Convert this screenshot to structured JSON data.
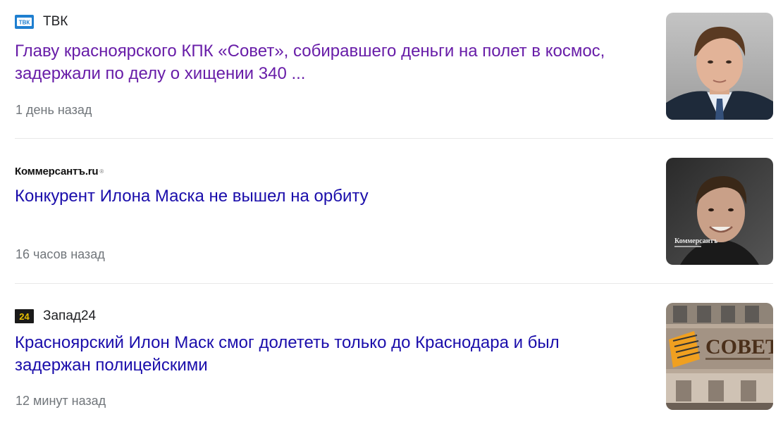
{
  "news": [
    {
      "source": "ТВК",
      "source_logo_text": "ТВК",
      "headline": "Главу красноярского КПК «Совет», собиравшего деньги на полет в космос, задержали по делу о хищении 340 ...",
      "time": "1 день назад",
      "visited": true
    },
    {
      "source": "",
      "source_logo_text": "Коммерсантъ.ru",
      "headline": "Конкурент Илона Маска не вышел на орбиту",
      "time": "16 часов назад",
      "thumb_watermark": "Коммерсантъ",
      "visited": false
    },
    {
      "source": "Запад24",
      "source_logo_text": "24",
      "headline": "Красноярский Илон Маск смог долететь только до Краснодара и был задержан полицейскими",
      "time": "12 минут назад",
      "thumb_sign_text": "СОВЕТ",
      "visited": false
    }
  ],
  "colors": {
    "visited_link": "#681da8",
    "link": "#1a0dab",
    "meta": "#70757a",
    "source_text": "#202124",
    "tvk_logo_bg": "#1f7fd0",
    "zapad_logo_bg": "#1a1a1a",
    "zapad_logo_fg": "#e8c000"
  },
  "icons": [
    "tvk-logo-icon",
    "kommersant-logo-icon",
    "zapad24-logo-icon"
  ]
}
